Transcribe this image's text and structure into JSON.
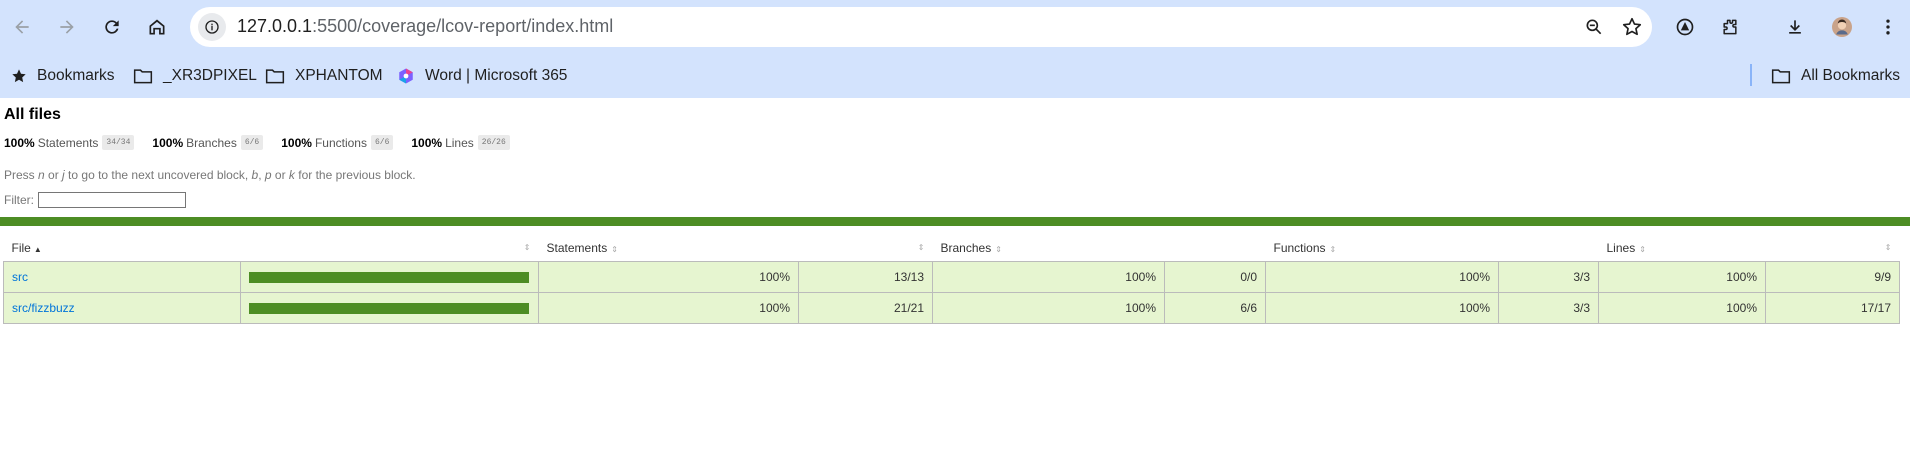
{
  "browser": {
    "url_host": "127.0.0.1",
    "url_path": ":5500/coverage/lcov-report/index.html",
    "icons": [
      "back-icon",
      "forward-icon",
      "reload-icon",
      "home-icon",
      "info-icon",
      "zoom-out-icon",
      "star-icon",
      "extension-icon",
      "puzzle-icon",
      "download-icon",
      "profile-avatar",
      "menu-icon"
    ]
  },
  "bookmarks": {
    "items": [
      {
        "label": "Bookmarks",
        "icon": "star-icon"
      },
      {
        "label": "_XR3DPIXEL",
        "icon": "folder-icon"
      },
      {
        "label": "XPHANTOM",
        "icon": "folder-icon"
      },
      {
        "label": "Word | Microsoft 365",
        "icon": "m365-icon"
      }
    ],
    "all_label": "All Bookmarks"
  },
  "report": {
    "title": "All files",
    "summary": [
      {
        "pct": "100%",
        "label": "Statements",
        "frac": "34/34"
      },
      {
        "pct": "100%",
        "label": "Branches",
        "frac": "6/6"
      },
      {
        "pct": "100%",
        "label": "Functions",
        "frac": "6/6"
      },
      {
        "pct": "100%",
        "label": "Lines",
        "frac": "26/26"
      }
    ],
    "hint": {
      "p1": "Press ",
      "k1": "n",
      "p2": " or ",
      "k2": "j",
      "p3": " to go to the next uncovered block, ",
      "k3": "b",
      "p4": ", ",
      "k4": "p",
      "p5": " or ",
      "k5": "k",
      "p6": " for the previous block."
    },
    "filter_label": "Filter:",
    "filter_value": "",
    "table": {
      "headers": {
        "file": "File",
        "statements": "Statements",
        "branches": "Branches",
        "functions": "Functions",
        "lines": "Lines"
      },
      "rows": [
        {
          "file": "src",
          "coverage": 1.0,
          "stmt_pct": "100%",
          "stmt_frac": "13/13",
          "br_pct": "100%",
          "br_frac": "0/0",
          "fn_pct": "100%",
          "fn_frac": "3/3",
          "ln_pct": "100%",
          "ln_frac": "9/9"
        },
        {
          "file": "src/fizzbuzz",
          "coverage": 1.0,
          "stmt_pct": "100%",
          "stmt_frac": "21/21",
          "br_pct": "100%",
          "br_frac": "6/6",
          "fn_pct": "100%",
          "fn_frac": "3/3",
          "ln_pct": "100%",
          "ln_frac": "17/17"
        }
      ]
    }
  }
}
